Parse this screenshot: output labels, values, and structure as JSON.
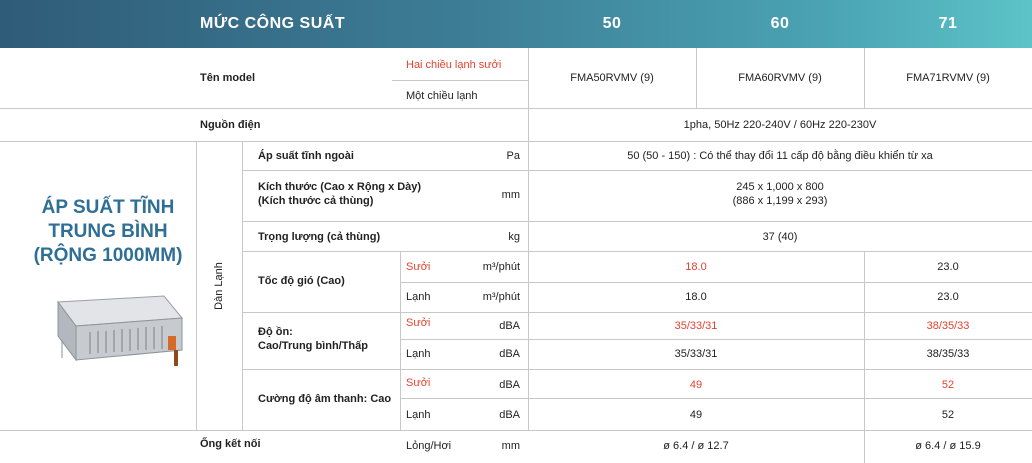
{
  "header": {
    "title": "MỨC CÔNG SUẤT",
    "cap1": "50",
    "cap2": "60",
    "cap3": "71"
  },
  "model": {
    "label": "Tên model",
    "heat_cool": "Hai chiều lạnh sưởi",
    "cool_only": "Một chiều lạnh",
    "m1": "FMA50RVMV (9)",
    "m2": "FMA60RVMV (9)",
    "m3": "FMA71RVMV (9)"
  },
  "power": {
    "label": "Nguồn điện",
    "value": "1pha, 50Hz 220-240V / 60Hz 220-230V"
  },
  "section": {
    "title": "ÁP SUẤT TĨNH TRUNG BÌNH (RỘNG 1000MM)",
    "indoor": "Dàn Lạnh"
  },
  "pressure": {
    "label": "Áp suất tĩnh ngoài",
    "unit": "Pa",
    "value": "50 (50 - 150) : Có thể thay đổi 11 cấp độ bằng điều khiển từ xa"
  },
  "dimensions": {
    "label1": "Kích thước (Cao x Rộng x Dày)",
    "label2": "(Kích thước cả thùng)",
    "unit": "mm",
    "value1": "245 x 1,000 x 800",
    "value2": "(886 x 1,199 x 293)"
  },
  "weight": {
    "label": "Trọng lượng (cả thùng)",
    "unit": "kg",
    "value": "37 (40)"
  },
  "airflow": {
    "label": "Tốc độ gió (Cao)",
    "heat": "Sưởi",
    "cool": "Lạnh",
    "unit": "m³/phút",
    "heat_a": "18.0",
    "heat_b": "23.0",
    "cool_a": "18.0",
    "cool_b": "23.0"
  },
  "noise": {
    "label1": "Độ ồn:",
    "label2": "Cao/Trung bình/Thấp",
    "heat": "Sưởi",
    "cool": "Lạnh",
    "unit": "dBA",
    "heat_a": "35/33/31",
    "heat_b": "38/35/33",
    "cool_a": "35/33/31",
    "cool_b": "38/35/33"
  },
  "sound": {
    "label": "Cường độ âm thanh: Cao",
    "heat": "Sưởi",
    "cool": "Lạnh",
    "unit": "dBA",
    "heat_a": "49",
    "heat_b": "52",
    "cool_a": "49",
    "cool_b": "52"
  },
  "pipe": {
    "label": "Ống kết nối",
    "type": "Lỏng/Hơi",
    "unit": "mm",
    "value_a": "ø 6.4 / ø 12.7",
    "value_b": "ø 6.4 / ø 15.9"
  },
  "colors": {
    "header_start": "#2f5c78",
    "header_end": "#5dc3c8",
    "accent_red": "#e0432f",
    "title_blue": "#2f6f96"
  }
}
